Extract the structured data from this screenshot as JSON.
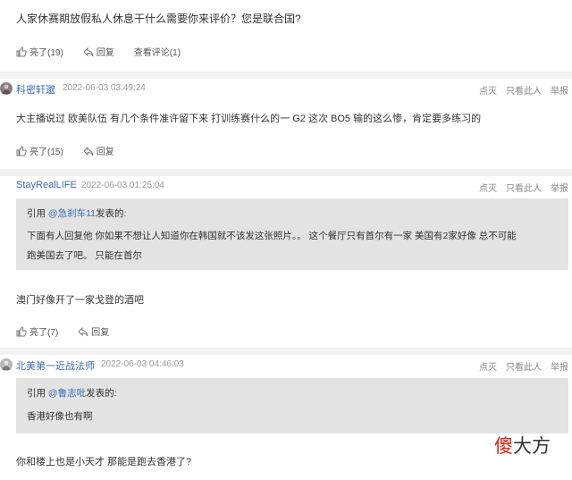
{
  "comments": [
    {
      "text": "人家休赛期放假私人休息干什么需要你来评价？您是联合国?",
      "likes": "亮了(19)",
      "reply": "回复",
      "view_reply": "查看评论(1)"
    },
    {
      "user": "科密轩邈",
      "time": "2022-06-03 03:49:24",
      "links": [
        "点灭",
        "只看此人",
        "举报"
      ],
      "text": "大主播说过 欧美队伍 有几个条件准许留下来 打训练赛什么的一 G2 这次 BO5 输的这么惨，肯定要多练习的",
      "likes": "亮了(15)",
      "reply": "回复"
    },
    {
      "user": "StayRealLIFE",
      "time": "2022-06-03 01:25:04",
      "links": [
        "点灭",
        "只看此人",
        "举报"
      ],
      "quote": {
        "prefix": "引用",
        "mention": "@急刹车11",
        "suffix": "发表的:",
        "line1": "下面有人回复他   你如果不想让人知道你在韩国就不该发这张照片。。   这个餐厅只有首尔有一家   美国有2家好像    总不可能",
        "line2": "跑美国去了吧。  只能在首尔"
      },
      "text": "澳门好像开了一家戈登的酒吧",
      "likes": "亮了(7)",
      "reply": "回复"
    },
    {
      "user": "北美第一近战法师",
      "time": "2022-06-03 04:46:03",
      "links": [
        "点灭",
        "只看此人",
        "举报"
      ],
      "quote": {
        "prefix": "引用",
        "mention": "@鲁志吡",
        "suffix": "发表的:",
        "line1": "香港好像也有啊"
      },
      "text": "你和楼上也是小天才 那能是跑去香港了?"
    }
  ],
  "watermark": {
    "part1": "傻",
    "part2": "大方"
  },
  "colors": {
    "link": "#3a6cb5",
    "quote_bg": "#e3e3e3",
    "separator": "#f2f2f2",
    "watermark_red": "#d81e06"
  },
  "icons": {
    "like": "thumbs-up-icon",
    "reply": "reply-arrow-icon",
    "avatar": "user-avatar"
  }
}
